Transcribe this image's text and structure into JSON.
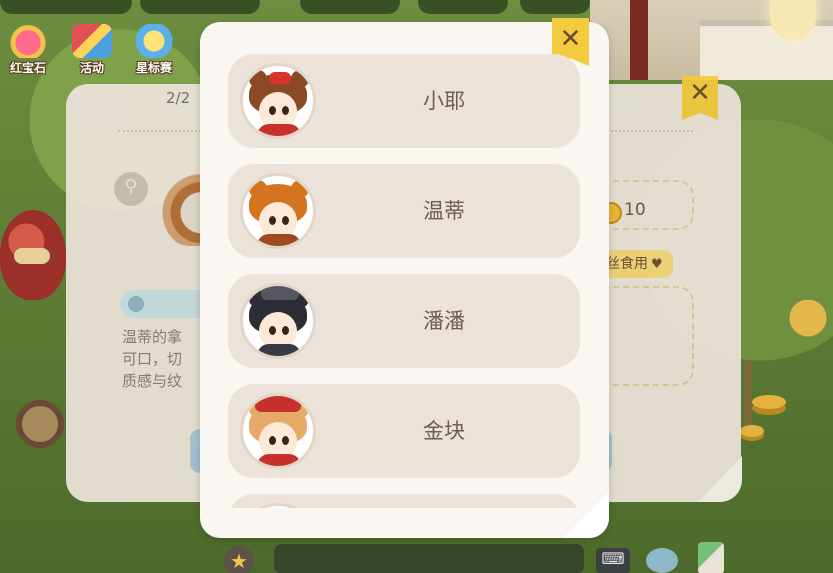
{
  "hud": {
    "menu_icons": [
      {
        "label": "红宝石",
        "icon": "ruby-gift-icon"
      },
      {
        "label": "活动",
        "icon": "event-flag-icon"
      },
      {
        "label": "星标赛",
        "icon": "star-race-icon"
      }
    ]
  },
  "background_panel": {
    "close_symbol": "✕",
    "search_icon": "magnifier-icon",
    "coin_count": "10",
    "tag_label": "丝食用",
    "tag_heart": "♥",
    "stat_text": "2/2",
    "description": "温蒂的拿\n可口，切\n质感与纹"
  },
  "modal": {
    "close_symbol": "✕",
    "characters": [
      {
        "name": "小耶",
        "avatar": "girl-bear-ears-red-bow-avatar"
      },
      {
        "name": "温蒂",
        "avatar": "orange-hair-bear-ears-avatar"
      },
      {
        "name": "潘潘",
        "avatar": "black-hair-goggles-avatar"
      },
      {
        "name": "金块",
        "avatar": "golden-dog-red-cap-avatar"
      },
      {
        "name": "",
        "avatar": "partially-visible-avatar"
      }
    ]
  },
  "bottom_bar": {
    "star_symbol": "★",
    "keyboard_symbol": "⌨"
  },
  "colors": {
    "accent_yellow": "#f4ca3e",
    "modal_bg": "#faf6f1",
    "row_bg": "#ebe3d9",
    "name_text": "#6f5d50"
  }
}
